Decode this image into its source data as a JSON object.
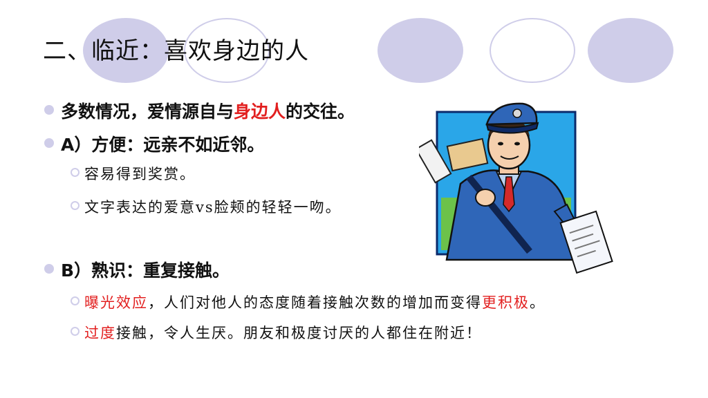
{
  "title": "二、临近：喜欢身边的人",
  "point1": {
    "a": "多数情况，爱情源自与",
    "b": "身边人",
    "c": "的交往。"
  },
  "point2": {
    "text": "A）方便：远亲不如近邻。"
  },
  "point2_subs": [
    {
      "text": "容易得到奖赏。"
    },
    {
      "text": "文字表达的爱意vs脸颊的轻轻一吻。"
    }
  ],
  "point3": {
    "text": "B）熟识：重复接触。"
  },
  "point3_sub1": {
    "a": "曝光效应",
    "b": "，人们对他人的态度随着接触次数的增加而变得",
    "c": "更积极",
    "d": "。"
  },
  "point3_sub2": {
    "a": "过度",
    "b": "接触，令人生厌。朋友和极度讨厌的人都住在附近！"
  },
  "colors": {
    "accent": "#cfcde9",
    "highlight": "#e21f1f",
    "frame": "#1a8fd8"
  },
  "illustration": {
    "icon": "mailman-illustration"
  }
}
